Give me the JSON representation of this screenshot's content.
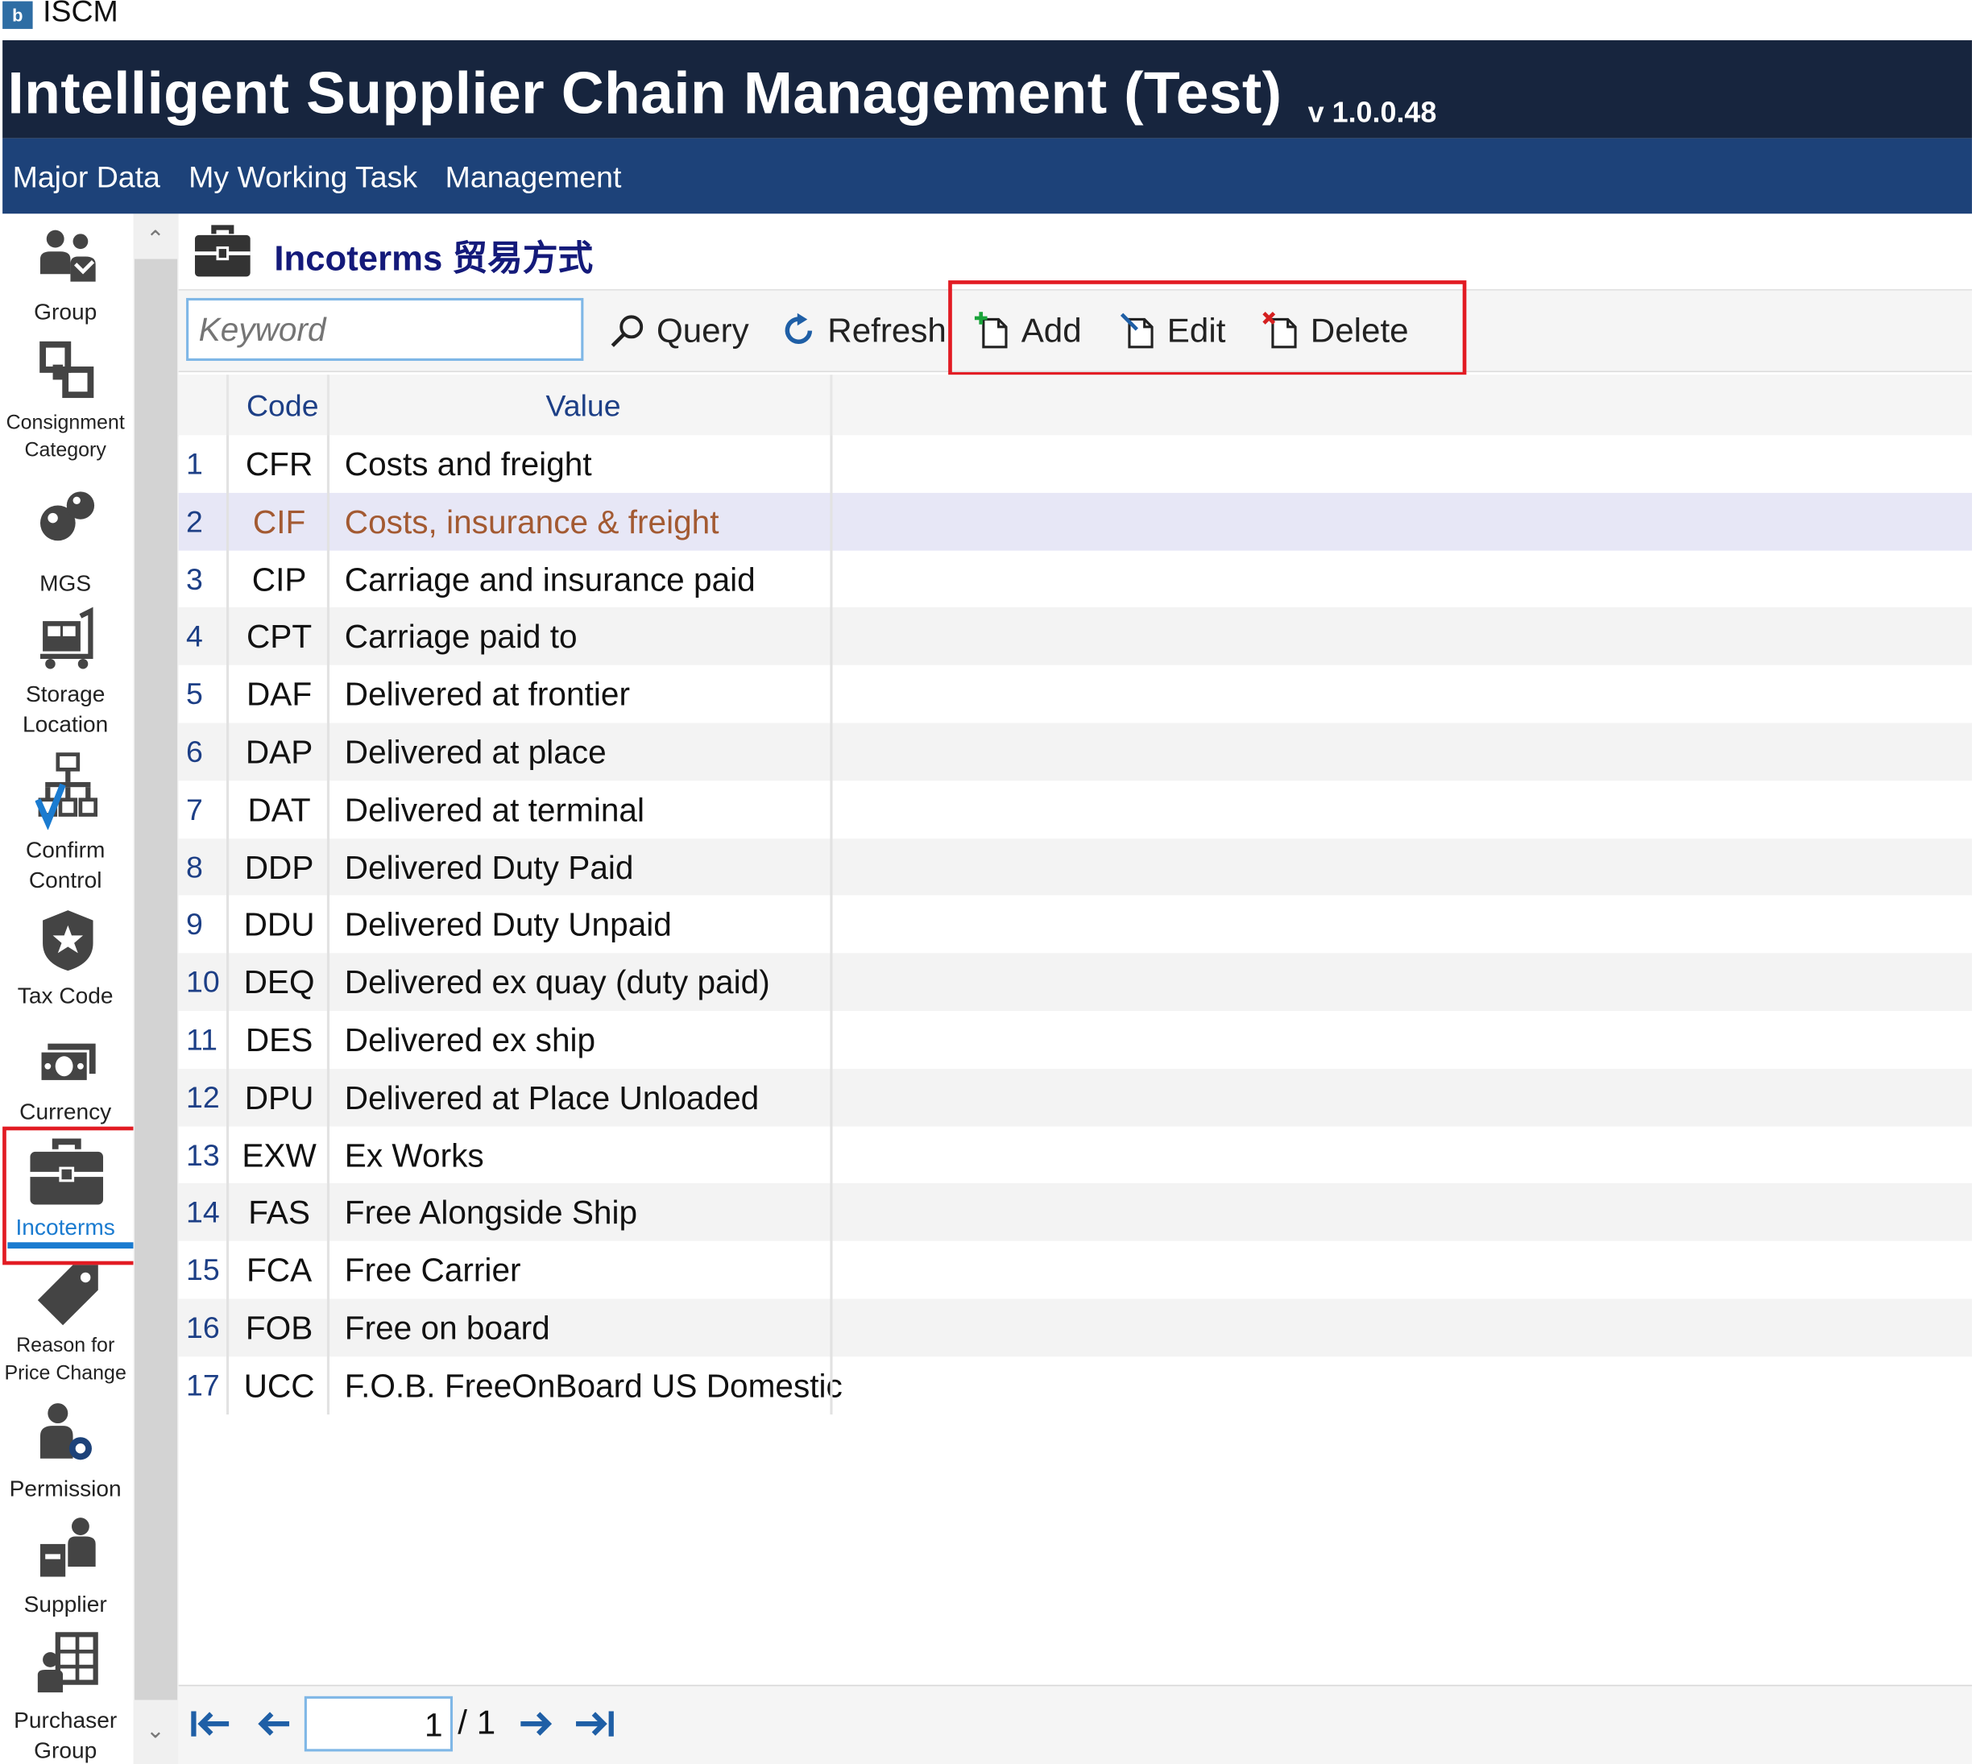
{
  "window": {
    "app_title": "ISCM"
  },
  "header": {
    "title": "Intelligent Supplier Chain Management (Test)",
    "version": "v 1.0.0.48"
  },
  "menu": [
    "Major Data",
    "My Working Task",
    "Management"
  ],
  "nav": {
    "items": [
      {
        "label": "Group",
        "icon": "group-icon"
      },
      {
        "label": "Consignment\nCategory",
        "icon": "consignment-category-icon"
      },
      {
        "label": "MGS",
        "icon": "mgs-icon"
      },
      {
        "label": "Storage\nLocation",
        "icon": "storage-location-icon"
      },
      {
        "label": "Confirm\nControl",
        "icon": "confirm-control-icon"
      },
      {
        "label": "Tax Code",
        "icon": "tax-code-icon"
      },
      {
        "label": "Currency",
        "icon": "currency-icon"
      },
      {
        "label": "Incoterms",
        "icon": "briefcase-icon"
      },
      {
        "label": "Reason for\nPrice Change",
        "icon": "price-tag-icon"
      },
      {
        "label": "Permission",
        "icon": "permission-icon"
      },
      {
        "label": "Supplier",
        "icon": "supplier-icon"
      },
      {
        "label": "Purchaser\nGroup",
        "icon": "purchaser-group-icon"
      }
    ],
    "active": "Incoterms"
  },
  "page": {
    "title": "Incoterms 贸易方式"
  },
  "toolbar": {
    "search_placeholder": "Keyword",
    "query": "Query",
    "refresh": "Refresh",
    "add": "Add",
    "edit": "Edit",
    "delete": "Delete"
  },
  "table": {
    "columns": [
      "Code",
      "Value"
    ],
    "selected_row": 2,
    "rows": [
      {
        "num": "1",
        "code": "CFR",
        "value": "Costs and freight"
      },
      {
        "num": "2",
        "code": "CIF",
        "value": "Costs, insurance & freight"
      },
      {
        "num": "3",
        "code": "CIP",
        "value": "Carriage and insurance paid"
      },
      {
        "num": "4",
        "code": "CPT",
        "value": "Carriage paid to"
      },
      {
        "num": "5",
        "code": "DAF",
        "value": "Delivered at frontier"
      },
      {
        "num": "6",
        "code": "DAP",
        "value": "Delivered at place"
      },
      {
        "num": "7",
        "code": "DAT",
        "value": "Delivered at terminal"
      },
      {
        "num": "8",
        "code": "DDP",
        "value": "Delivered Duty Paid"
      },
      {
        "num": "9",
        "code": "DDU",
        "value": "Delivered Duty Unpaid"
      },
      {
        "num": "10",
        "code": "DEQ",
        "value": "Delivered ex quay (duty paid)"
      },
      {
        "num": "11",
        "code": "DES",
        "value": "Delivered ex ship"
      },
      {
        "num": "12",
        "code": "DPU",
        "value": "Delivered at Place Unloaded"
      },
      {
        "num": "13",
        "code": "EXW",
        "value": "Ex Works"
      },
      {
        "num": "14",
        "code": "FAS",
        "value": "Free Alongside Ship"
      },
      {
        "num": "15",
        "code": "FCA",
        "value": "Free Carrier"
      },
      {
        "num": "16",
        "code": "FOB",
        "value": "Free on board"
      },
      {
        "num": "17",
        "code": "UCC",
        "value": "F.O.B. FreeOnBoard US Domestic"
      }
    ]
  },
  "pager": {
    "current_page": "1",
    "total_label": "/ 1"
  },
  "colors": {
    "banner": "#17253e",
    "menubar": "#1d4279",
    "highlight_box": "#e21b23",
    "selected_text": "#a35a32",
    "active_nav": "#1a7bd0"
  }
}
